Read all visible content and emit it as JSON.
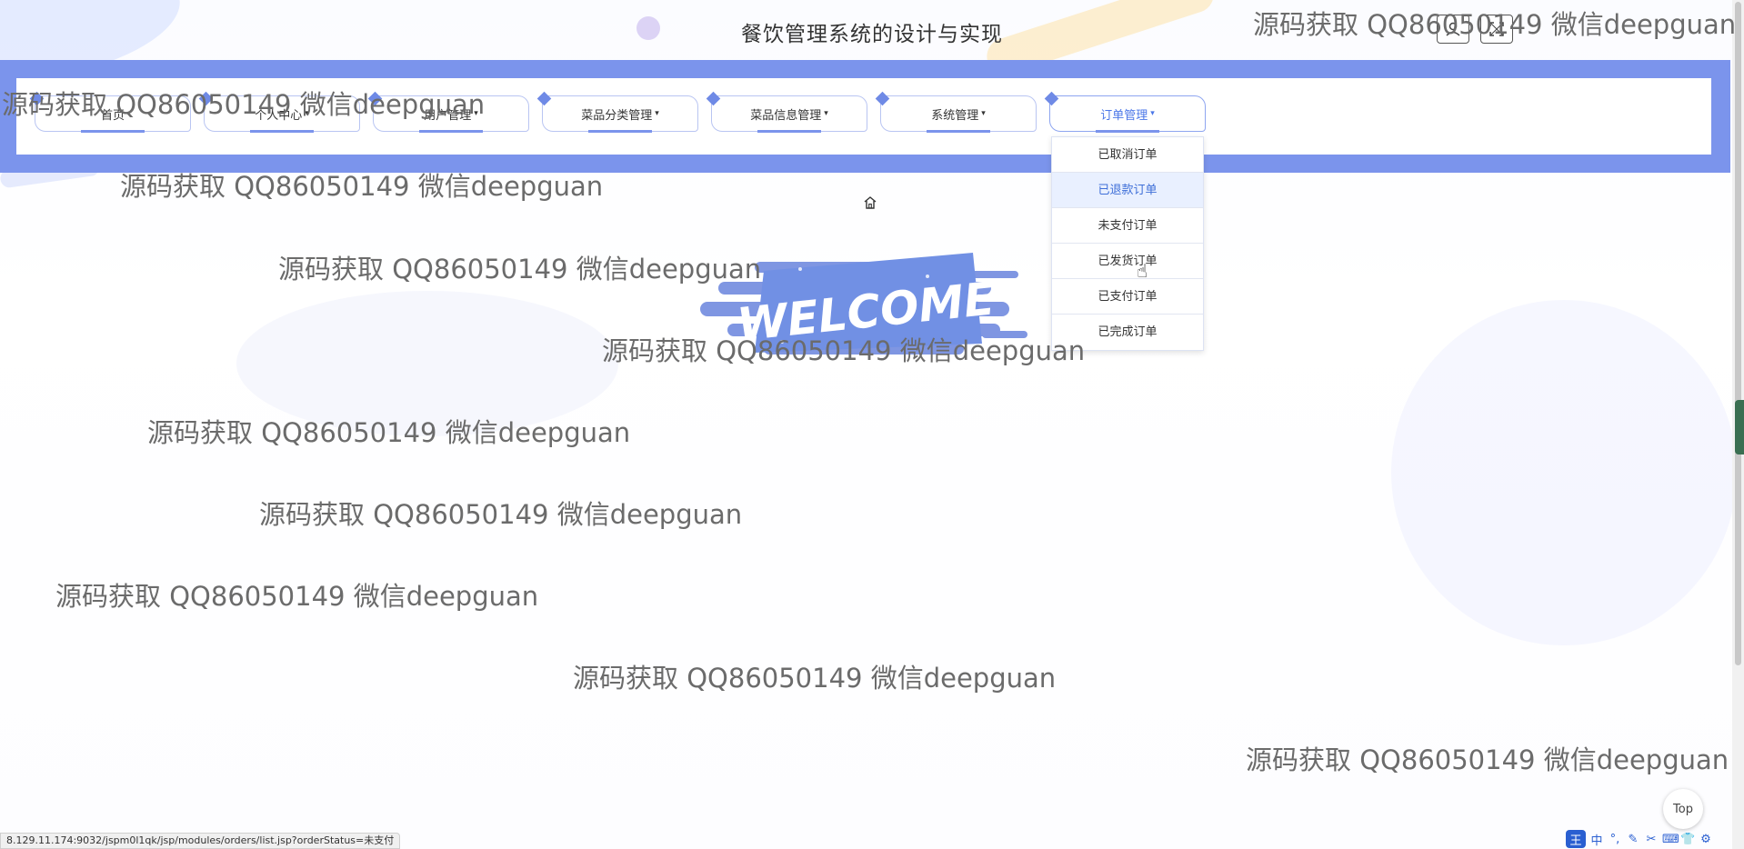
{
  "header": {
    "title": "餐饮管理系统的设计与实现",
    "icons": [
      "user-icon",
      "fullscreen-icon"
    ]
  },
  "nav": {
    "items": [
      {
        "label": "首页",
        "has_caret": false
      },
      {
        "label": "个人中心",
        "has_caret": true
      },
      {
        "label": "用户管理",
        "has_caret": true
      },
      {
        "label": "菜品分类管理",
        "has_caret": true
      },
      {
        "label": "菜品信息管理",
        "has_caret": true
      },
      {
        "label": "系统管理",
        "has_caret": true
      },
      {
        "label": "订单管理",
        "has_caret": true
      }
    ],
    "caret": "▾",
    "active_index": 6
  },
  "dropdown": {
    "items": [
      "已取消订单",
      "已退款订单",
      "未支付订单",
      "已发货订单",
      "已支付订单",
      "已完成订单"
    ],
    "hover_index": 1
  },
  "welcome": {
    "text": "WELCOME"
  },
  "watermark": {
    "text": "源码获取 QQ86050149 微信deepguan"
  },
  "top_button": {
    "label": "Top"
  },
  "status_bar": {
    "url": "8.129.11.174:9032/jspm0l1qk/jsp/modules/orders/list.jsp?orderStatus=未支付"
  },
  "ime": {
    "logo": "王",
    "mode": "中"
  },
  "colors": {
    "nav_band": "#7b94ec",
    "accent": "#4a76e8",
    "hover_bg": "#e9f0ff"
  }
}
